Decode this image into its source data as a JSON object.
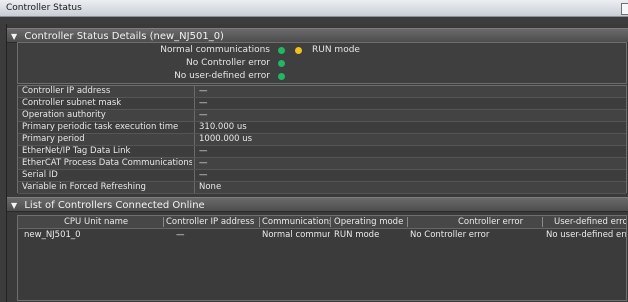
{
  "window": {
    "title": "Controller Status"
  },
  "status_section": {
    "title": "Controller Status Details (new_NJ501_0)",
    "lines": [
      {
        "label": "Normal communications",
        "indicator": "green"
      },
      {
        "label": "No Controller error",
        "indicator": "green"
      },
      {
        "label": "No user-defined error",
        "indicator": "green"
      }
    ],
    "mode_indicator": "yellow",
    "mode_text": "RUN mode"
  },
  "properties": [
    {
      "key": "Controller IP address",
      "value": "—"
    },
    {
      "key": "Controller subnet mask",
      "value": "—"
    },
    {
      "key": "Operation authority",
      "value": "—"
    },
    {
      "key": "Primary periodic task execution time",
      "value": "310.000 us"
    },
    {
      "key": "Primary period",
      "value": "1000.000 us"
    },
    {
      "key": "EtherNet/IP Tag Data Link",
      "value": "—"
    },
    {
      "key": "EtherCAT Process Data Communications",
      "value": "—"
    },
    {
      "key": "Serial ID",
      "value": "—"
    },
    {
      "key": "Variable in Forced Refreshing",
      "value": "None"
    }
  ],
  "list_section": {
    "title": "List of Controllers Connected Online",
    "columns": [
      "CPU Unit name",
      "Controller IP address",
      "Communications",
      "Operating mode",
      "Controller error",
      "User-defined error"
    ],
    "rows": [
      [
        "new_NJ501_0",
        "—",
        "Normal commun",
        "RUN mode",
        "No Controller error",
        "No user-defined errc"
      ]
    ]
  },
  "colors": {
    "green": "#20b860",
    "yellow": "#f2c21a",
    "background": "#3c3c3c"
  }
}
